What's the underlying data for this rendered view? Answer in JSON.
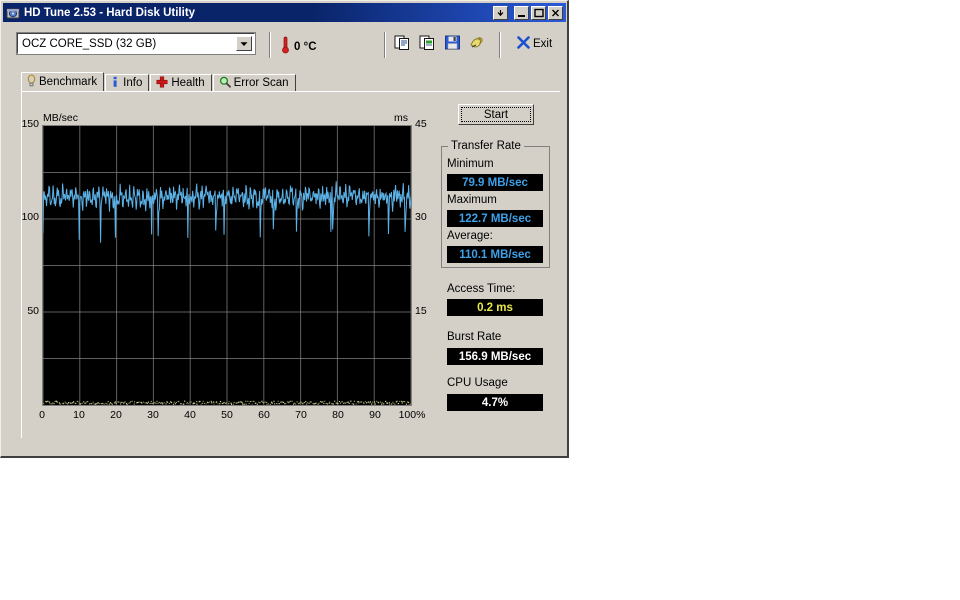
{
  "window": {
    "title": "HD Tune 2.53 - Hard Disk Utility",
    "icon": "hard-disk-icon",
    "buttons": {
      "extra": "▼",
      "minimize": "_",
      "maximize": "□",
      "close": "✕"
    }
  },
  "toolbar": {
    "drive_selected": "OCZ CORE_SSD (32 GB)",
    "drive_options": [
      "OCZ CORE_SSD (32 GB)"
    ],
    "dropdown_arrow": "▼",
    "temperature": "0 °C",
    "temperature_icon": "thermometer-icon",
    "icons": [
      {
        "name": "copy-icon",
        "label": "Copy"
      },
      {
        "name": "copy-color-icon",
        "label": "Copy color"
      },
      {
        "name": "save-icon",
        "label": "Save"
      },
      {
        "name": "print-icon",
        "label": "Print"
      }
    ],
    "exit_label": "Exit",
    "exit_icon": "close-x-icon"
  },
  "tabs": [
    {
      "label": "Benchmark",
      "icon": "lightbulb-icon",
      "active": true
    },
    {
      "label": "Info",
      "icon": "info-icon",
      "active": false
    },
    {
      "label": "Health",
      "icon": "red-cross-icon",
      "active": false
    },
    {
      "label": "Error Scan",
      "icon": "magnifier-icon",
      "active": false
    }
  ],
  "benchmark": {
    "start_label": "Start",
    "transfer_rate_group": "Transfer Rate",
    "minimum_label": "Minimum",
    "minimum_value": "79.9 MB/sec",
    "maximum_label": "Maximum",
    "maximum_value": "122.7 MB/sec",
    "average_label": "Average:",
    "average_value": "110.1 MB/sec",
    "access_time_label": "Access Time:",
    "access_time_value": "0.2 ms",
    "burst_rate_label": "Burst Rate",
    "burst_rate_value": "156.9 MB/sec",
    "cpu_usage_label": "CPU Usage",
    "cpu_usage_value": "4.7%"
  },
  "colors": {
    "transfer_line": "#5cb3e8",
    "access_dots": "#e8e8a0",
    "grid": "#808080",
    "plot_bg": "#000000",
    "titlebar": "#0a246a",
    "face": "#d4d0c8",
    "value_blue": "#3ea0e8",
    "value_yellow": "#e8e84a"
  },
  "chart_data": {
    "type": "line",
    "title": "",
    "xlabel": "",
    "ylabel": "MB/sec",
    "y2label": "ms",
    "xlim": [
      0,
      100
    ],
    "ylim": [
      0,
      150
    ],
    "y2lim": [
      0,
      45
    ],
    "grid": true,
    "xticks": [
      "0",
      "10",
      "20",
      "30",
      "40",
      "50",
      "60",
      "70",
      "80",
      "90",
      "100%"
    ],
    "xtick_values": [
      0,
      10,
      20,
      30,
      40,
      50,
      60,
      70,
      80,
      90,
      100
    ],
    "yticks": [
      "150",
      "100",
      "50"
    ],
    "ytick_values": [
      150,
      100,
      50
    ],
    "y2ticks": [
      "45",
      "30",
      "15"
    ],
    "y2tick_values": [
      45,
      30,
      15
    ],
    "legend": [],
    "series": [
      {
        "name": "Transfer rate",
        "axis": "left",
        "unit": "MB/sec",
        "color": "#5cb3e8",
        "minimum": 79.9,
        "maximum": 122.7,
        "average": 110.1,
        "description": "Dense high-frequency oscillation between roughly 100 and 123 MB/sec across the whole span, with periodic deep dips reaching about 80 MB/sec."
      },
      {
        "name": "Access time",
        "axis": "right",
        "unit": "ms",
        "color": "#e8e8a0",
        "average": 0.2,
        "description": "Flat band of sample dots along the bottom of the plot at approximately 0.2 ms."
      }
    ]
  }
}
